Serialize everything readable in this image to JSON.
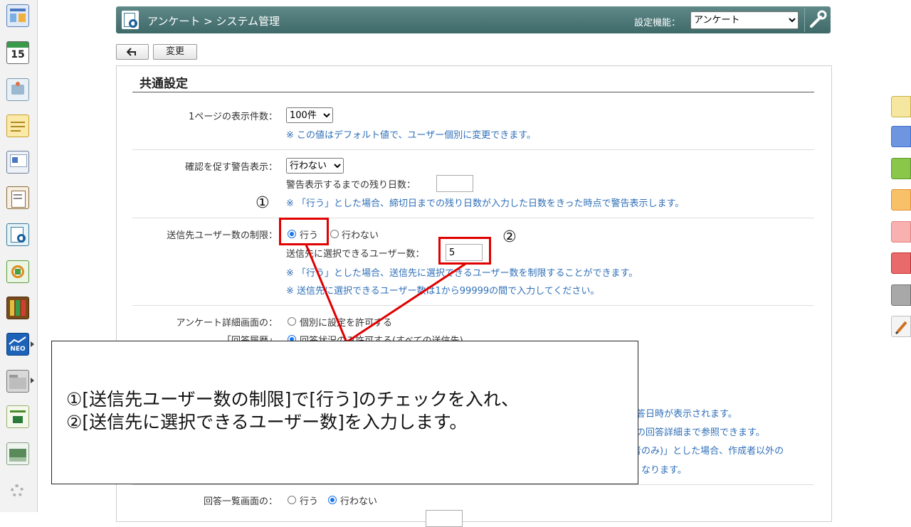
{
  "header": {
    "title": "アンケート > システム管理",
    "settings_label": "設定機能：",
    "function_selected": "アンケート"
  },
  "toolbar": {
    "back_icon": "back-arrow-icon",
    "change_label": "変更"
  },
  "section": {
    "title": "共通設定"
  },
  "rows": {
    "per_page": {
      "label": "1ページの表示件数：",
      "selected": "100件",
      "note": "※ この値はデフォルト値で、ユーザー個別に変更できます。"
    },
    "warning": {
      "label": "確認を促す警告表示：",
      "selected": "行わない",
      "days_label": "警告表示するまでの残り日数：",
      "days_value": "",
      "note": "※ 「行う」とした場合、締切日までの残り日数が入力した日数をきった時点で警告表示します。"
    },
    "recipient_limit": {
      "label": "送信先ユーザー数の制限：",
      "option_yes": "行う",
      "option_no": "行わない",
      "selected": "行う",
      "count_label": "送信先に選択できるユーザー数：",
      "count_value": "5",
      "note1": "※ 「行う」とした場合、送信先に選択できるユーザー数を制限することができます。",
      "note2": "※ 送信先に選択できるユーザー数は1から99999の間で入力してください。"
    },
    "detail_screen": {
      "label1": "アンケート詳細画面の：",
      "label2": "「回答履歴」",
      "option1": "個別に設定を許可する",
      "option2": "回答状況のみ許可する(すべての送信先)",
      "note_fragment1": "答日時が表示されます。",
      "note_fragment2": "の回答詳細まで参照できます。",
      "note_fragment3": "者のみ)」とした場合、作成者以外の",
      "note_fragment4": "くなります。"
    },
    "answer_list": {
      "label": "回答一覧画面の：",
      "option_yes": "行う",
      "option_no": "行わない",
      "selected": "行わない"
    }
  },
  "annotation": {
    "marker1": "①",
    "marker2": "②",
    "line1": "①[送信先ユーザー数の制限]で[行う]のチェックを入れ、",
    "line2": "②[送信先に選択できるユーザー数]を入力します。"
  },
  "sidebar": {
    "calendar_day": "15",
    "neo_label": "NEO",
    "icons": [
      "portal-icon",
      "calendar-icon",
      "facility-icon",
      "memo-icon",
      "bulletin-icon",
      "report-icon",
      "survey-icon",
      "workflow-icon",
      "cabinet-icon",
      "neo-icon",
      "folder-icon",
      "app-tile-icon",
      "app-tile-2-icon",
      "settings-gear-icon"
    ]
  },
  "colors": {
    "header": "#4e7a7a",
    "note_text": "#2f6fb8",
    "annotation_red": "#e00000",
    "radio_selected": "#1a73e8"
  }
}
